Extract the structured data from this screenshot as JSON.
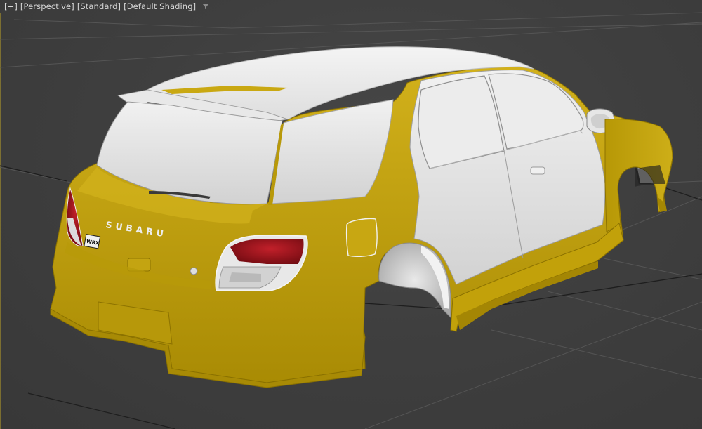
{
  "viewport": {
    "plus_menu": "[+]",
    "point_of_view": "[Perspective]",
    "render_mode": "[Standard]",
    "shading_mode": "[Default Shading]",
    "filter_icon": "funnel-icon"
  },
  "model": {
    "badge": "SUBARU",
    "plate": "WRX",
    "colors": {
      "body": "#c3a20c",
      "body_shadow": "#8f7500",
      "body_highlight": "#d8b827",
      "panel": "#e6e6e6",
      "panel_shadow": "#b9b9b9",
      "taillight": "#9b0f18",
      "grid": "#5a5a5a",
      "grid_major": "#1c1c1c"
    }
  }
}
